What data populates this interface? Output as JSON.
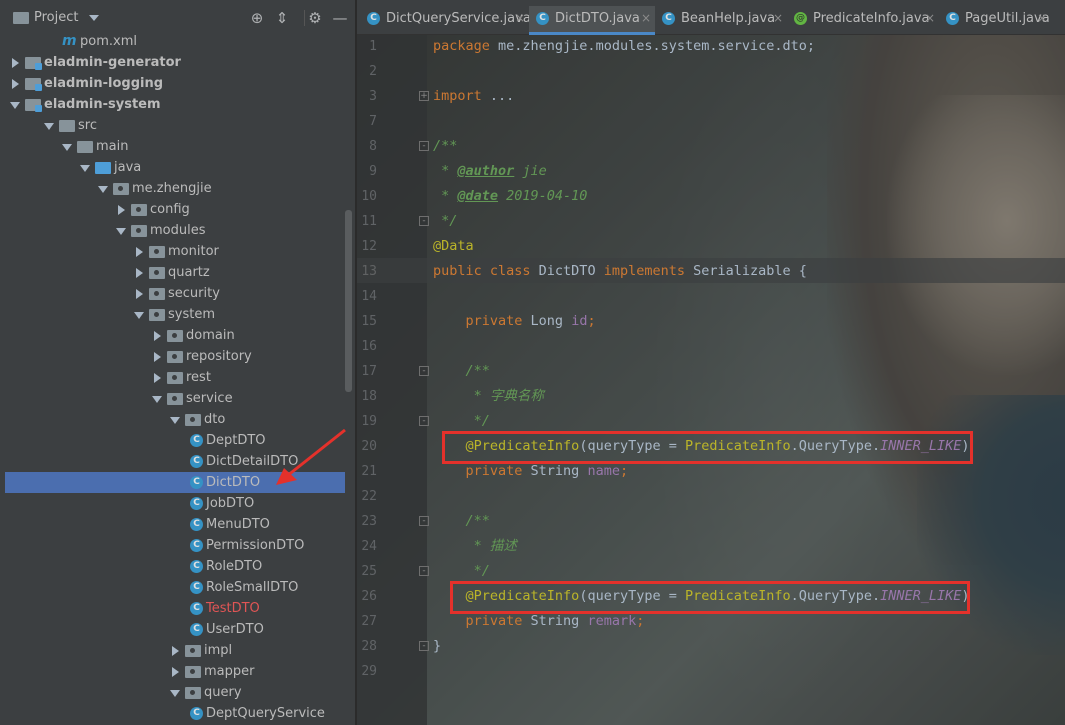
{
  "project_panel": {
    "title": "Project",
    "icons": [
      "locate-icon",
      "collapse-all-icon",
      "settings-icon",
      "hide-panel-icon"
    ]
  },
  "tree": [
    {
      "label": "pom.xml",
      "kind": "maven-file",
      "depth": 0,
      "expanded": null
    },
    {
      "label": "eladmin-generator",
      "kind": "module",
      "depth": 0,
      "expanded": false
    },
    {
      "label": "eladmin-logging",
      "kind": "module",
      "depth": 0,
      "expanded": false
    },
    {
      "label": "eladmin-system",
      "kind": "module",
      "depth": 0,
      "expanded": true
    },
    {
      "label": "src",
      "kind": "folder",
      "depth": 1,
      "expanded": true
    },
    {
      "label": "main",
      "kind": "folder",
      "depth": 2,
      "expanded": true
    },
    {
      "label": "java",
      "kind": "source-folder",
      "depth": 3,
      "expanded": true
    },
    {
      "label": "me.zhengjie",
      "kind": "package",
      "depth": 4,
      "expanded": true
    },
    {
      "label": "config",
      "kind": "package",
      "depth": 5,
      "expanded": false
    },
    {
      "label": "modules",
      "kind": "package",
      "depth": 5,
      "expanded": true
    },
    {
      "label": "monitor",
      "kind": "package",
      "depth": 6,
      "expanded": false
    },
    {
      "label": "quartz",
      "kind": "package",
      "depth": 6,
      "expanded": false
    },
    {
      "label": "security",
      "kind": "package",
      "depth": 6,
      "expanded": false
    },
    {
      "label": "system",
      "kind": "package",
      "depth": 6,
      "expanded": true
    },
    {
      "label": "domain",
      "kind": "package",
      "depth": 7,
      "expanded": false
    },
    {
      "label": "repository",
      "kind": "package",
      "depth": 7,
      "expanded": false
    },
    {
      "label": "rest",
      "kind": "package",
      "depth": 7,
      "expanded": false
    },
    {
      "label": "service",
      "kind": "package",
      "depth": 7,
      "expanded": true
    },
    {
      "label": "dto",
      "kind": "package",
      "depth": 8,
      "expanded": true
    },
    {
      "label": "DeptDTO",
      "kind": "class",
      "depth": 9,
      "expanded": null
    },
    {
      "label": "DictDetailDTO",
      "kind": "class",
      "depth": 9,
      "expanded": null
    },
    {
      "label": "DictDTO",
      "kind": "class",
      "depth": 9,
      "expanded": null,
      "selected": true
    },
    {
      "label": "JobDTO",
      "kind": "class",
      "depth": 9,
      "expanded": null
    },
    {
      "label": "MenuDTO",
      "kind": "class",
      "depth": 9,
      "expanded": null
    },
    {
      "label": "PermissionDTO",
      "kind": "class",
      "depth": 9,
      "expanded": null
    },
    {
      "label": "RoleDTO",
      "kind": "class",
      "depth": 9,
      "expanded": null
    },
    {
      "label": "RoleSmallDTO",
      "kind": "class",
      "depth": 9,
      "expanded": null
    },
    {
      "label": "TestDTO",
      "kind": "class",
      "depth": 9,
      "expanded": null,
      "error": true
    },
    {
      "label": "UserDTO",
      "kind": "class",
      "depth": 9,
      "expanded": null
    },
    {
      "label": "impl",
      "kind": "package",
      "depth": 8,
      "expanded": false
    },
    {
      "label": "mapper",
      "kind": "package",
      "depth": 8,
      "expanded": false
    },
    {
      "label": "query",
      "kind": "package",
      "depth": 8,
      "expanded": true
    },
    {
      "label": "DeptQueryService",
      "kind": "class",
      "depth": 9,
      "expanded": null
    }
  ],
  "tabs": [
    {
      "label": "DictQueryService.java",
      "icon": "class-icon",
      "active": false
    },
    {
      "label": "DictDTO.java",
      "icon": "class-icon",
      "active": true
    },
    {
      "label": "BeanHelp.java",
      "icon": "class-icon",
      "active": false
    },
    {
      "label": "PredicateInfo.java",
      "icon": "annotation-icon",
      "active": false
    },
    {
      "label": "PageUtil.java",
      "icon": "class-icon",
      "active": false
    }
  ],
  "editor": {
    "current_line": 13,
    "lines": [
      {
        "n": 1,
        "tokens": [
          [
            "kw",
            "package "
          ],
          [
            "",
            "me.zhengjie.modules.system.service.dto;"
          ]
        ]
      },
      {
        "n": 2,
        "tokens": []
      },
      {
        "n": 3,
        "tokens": [
          [
            "kw",
            "import "
          ],
          [
            "",
            "..."
          ]
        ],
        "fold": "+"
      },
      {
        "n": 7,
        "tokens": []
      },
      {
        "n": 8,
        "tokens": [
          [
            "cm",
            "/**"
          ]
        ],
        "fold": "-"
      },
      {
        "n": 9,
        "tokens": [
          [
            "cm",
            " * "
          ],
          [
            "tag",
            "@author"
          ],
          [
            "cm",
            " jie"
          ]
        ]
      },
      {
        "n": 10,
        "tokens": [
          [
            "cm",
            " * "
          ],
          [
            "tag",
            "@date"
          ],
          [
            "cm",
            " 2019-04-10"
          ]
        ]
      },
      {
        "n": 11,
        "tokens": [
          [
            "cm",
            " */"
          ]
        ],
        "fold": "-"
      },
      {
        "n": 12,
        "tokens": [
          [
            "ann",
            "@Data"
          ]
        ]
      },
      {
        "n": 13,
        "tokens": [
          [
            "kw",
            "public class "
          ],
          [
            "",
            "DictDTO "
          ],
          [
            "kw",
            "implements "
          ],
          [
            "",
            "Serializable {"
          ]
        ]
      },
      {
        "n": 14,
        "tokens": []
      },
      {
        "n": 15,
        "tokens": [
          [
            "kw",
            "    private "
          ],
          [
            "",
            "Long "
          ],
          [
            "fld",
            "id"
          ],
          [
            "kw",
            ";"
          ]
        ]
      },
      {
        "n": 16,
        "tokens": []
      },
      {
        "n": 17,
        "tokens": [
          [
            "cm",
            "    /**"
          ]
        ],
        "fold": "-"
      },
      {
        "n": 18,
        "tokens": [
          [
            "cm",
            "     * 字典名称"
          ]
        ]
      },
      {
        "n": 19,
        "tokens": [
          [
            "cm",
            "     */"
          ]
        ],
        "fold": "-"
      },
      {
        "n": 20,
        "tokens": [
          [
            "ann",
            "    @PredicateInfo"
          ],
          [
            "",
            "(queryType = "
          ],
          [
            "ann",
            "PredicateInfo"
          ],
          [
            "",
            "."
          ],
          [
            "",
            "QueryType."
          ],
          [
            "cst",
            "INNER_LIKE"
          ],
          [
            "",
            ")"
          ]
        ]
      },
      {
        "n": 21,
        "tokens": [
          [
            "kw",
            "    private "
          ],
          [
            "",
            "String "
          ],
          [
            "fld",
            "name"
          ],
          [
            "kw",
            ";"
          ]
        ]
      },
      {
        "n": 22,
        "tokens": []
      },
      {
        "n": 23,
        "tokens": [
          [
            "cm",
            "    /**"
          ]
        ],
        "fold": "-"
      },
      {
        "n": 24,
        "tokens": [
          [
            "cm",
            "     * 描述"
          ]
        ]
      },
      {
        "n": 25,
        "tokens": [
          [
            "cm",
            "     */"
          ]
        ],
        "fold": "-"
      },
      {
        "n": 26,
        "tokens": [
          [
            "ann",
            "    @PredicateInfo"
          ],
          [
            "",
            "(queryType = "
          ],
          [
            "ann",
            "PredicateInfo"
          ],
          [
            "",
            "."
          ],
          [
            "",
            "QueryType."
          ],
          [
            "cst",
            "INNER_LIKE"
          ],
          [
            "",
            ")"
          ]
        ]
      },
      {
        "n": 27,
        "tokens": [
          [
            "kw",
            "    private "
          ],
          [
            "",
            "String "
          ],
          [
            "fld",
            "remark"
          ],
          [
            "kw",
            ";"
          ]
        ]
      },
      {
        "n": 28,
        "tokens": [
          [
            "",
            "}"
          ]
        ],
        "fold": "-"
      },
      {
        "n": 29,
        "tokens": []
      }
    ]
  },
  "colors": {
    "selection": "#4b6eaf",
    "annotation_highlight": "#e4312b",
    "keyword": "#cc7832",
    "annotation": "#bbb529",
    "comment": "#629755",
    "field": "#9876aa"
  }
}
